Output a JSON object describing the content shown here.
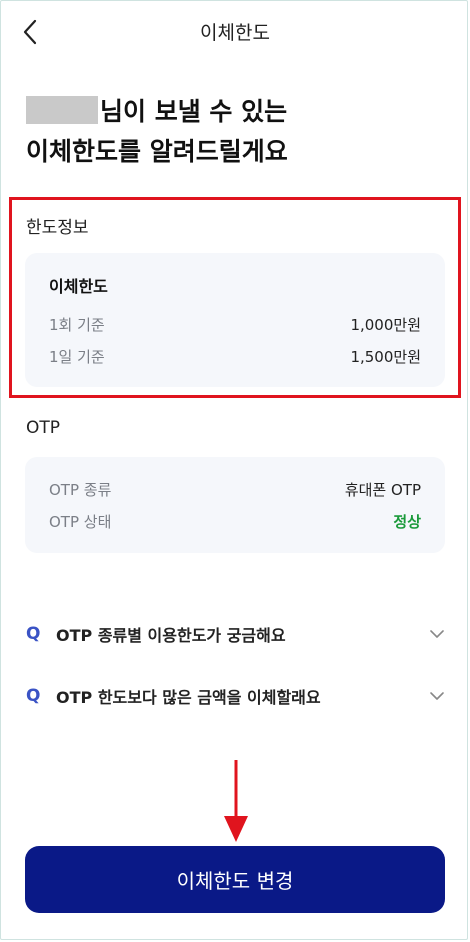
{
  "header": {
    "title": "이체한도",
    "back_icon": "chevron-left-icon"
  },
  "headline": {
    "line1_suffix": "님이 보낼 수 있는",
    "line2": "이체한도를 알려드릴게요"
  },
  "limit_section": {
    "label": "한도정보",
    "card_title": "이체한도",
    "rows": [
      {
        "key": "1회 기준",
        "value": "1,000만원"
      },
      {
        "key": "1일 기준",
        "value": "1,500만원"
      }
    ]
  },
  "otp_section": {
    "label": "OTP",
    "rows": [
      {
        "key": "OTP 종류",
        "value": "휴대폰 OTP"
      },
      {
        "key": "OTP 상태",
        "value": "정상"
      }
    ]
  },
  "faq": [
    {
      "q": "Q",
      "text": "OTP 종류별 이용한도가 궁금해요"
    },
    {
      "q": "Q",
      "text": "OTP 한도보다 많은 금액을 이체할래요"
    }
  ],
  "cta": {
    "label": "이체한도 변경"
  },
  "colors": {
    "highlight": "#e0141e",
    "cta_bg": "#0a1987",
    "faq_q": "#3a53c5",
    "status_ok": "#1a9a3a",
    "arrow": "#e0141e"
  }
}
